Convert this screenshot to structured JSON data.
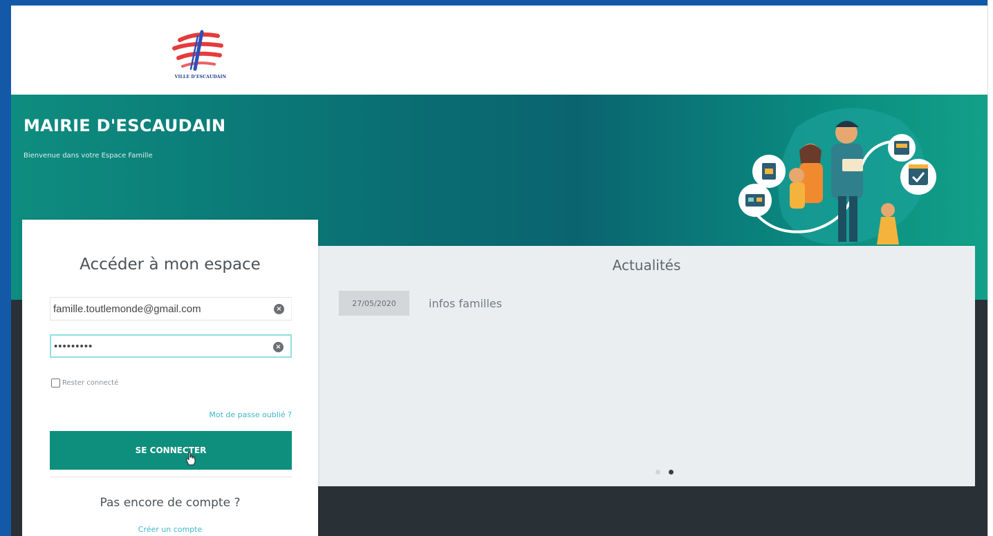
{
  "header": {
    "logo_caption": "VILLE D'ESCAUDAIN"
  },
  "banner": {
    "title": "MAIRIE D'ESCAUDAIN",
    "subtitle": "Bienvenue dans votre Espace Famille",
    "illustration_icon": "family-services-illustration"
  },
  "login": {
    "title": "Accéder à mon espace",
    "email_value": "famille.toutlemonde@gmail.com",
    "password_value": "password1",
    "remember_label": "Rester connecté",
    "forgot_label": "Mot de passe oublié ?",
    "submit_label": "SE CONNECTER",
    "no_account_label": "Pas encore de compte ?",
    "create_account_label": "Créer un compte"
  },
  "news": {
    "title": "Actualités",
    "items": [
      {
        "date": "27/05/2020",
        "label": "infos familles"
      }
    ],
    "pagination_active": 2,
    "pagination_total": 2
  },
  "colors": {
    "frame": "#1459a8",
    "banner_teal": "#0e8d7f",
    "button": "#0e8f7d",
    "link": "#3fb6c8",
    "dark_band": "#2a3136",
    "news_bg": "#ebeef1"
  }
}
